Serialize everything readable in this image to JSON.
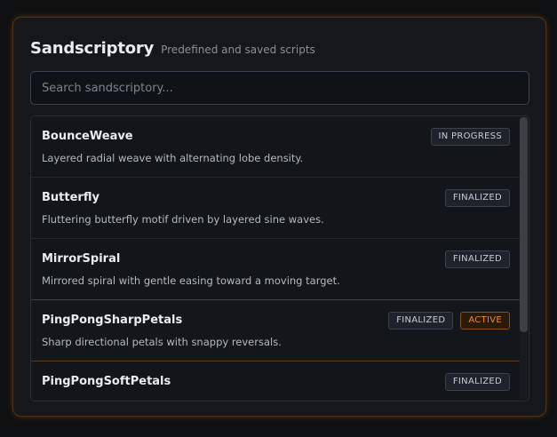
{
  "header": {
    "title": "Sandscriptory",
    "subtitle": "Predefined and saved scripts"
  },
  "search": {
    "placeholder": "Search sandscriptory...",
    "value": ""
  },
  "scripts": [
    {
      "name": "BounceWeave",
      "description": "Layered radial weave with alternating lobe density.",
      "status": "IN PROGRESS",
      "active_label": ""
    },
    {
      "name": "Butterfly",
      "description": "Fluttering butterfly motif driven by layered sine waves.",
      "status": "FINALIZED",
      "active_label": ""
    },
    {
      "name": "MirrorSpiral",
      "description": "Mirrored spiral with gentle easing toward a moving target.",
      "status": "FINALIZED",
      "active_label": ""
    },
    {
      "name": "PingPongSharpPetals",
      "description": "Sharp directional petals with snappy reversals.",
      "status": "FINALIZED",
      "active_label": "ACTIVE"
    },
    {
      "name": "PingPongSoftPetals",
      "description": "",
      "status": "FINALIZED",
      "active_label": ""
    }
  ],
  "colors": {
    "accent": "#f08a24",
    "panel_border": "#4a3016",
    "background": "#0f1012"
  }
}
